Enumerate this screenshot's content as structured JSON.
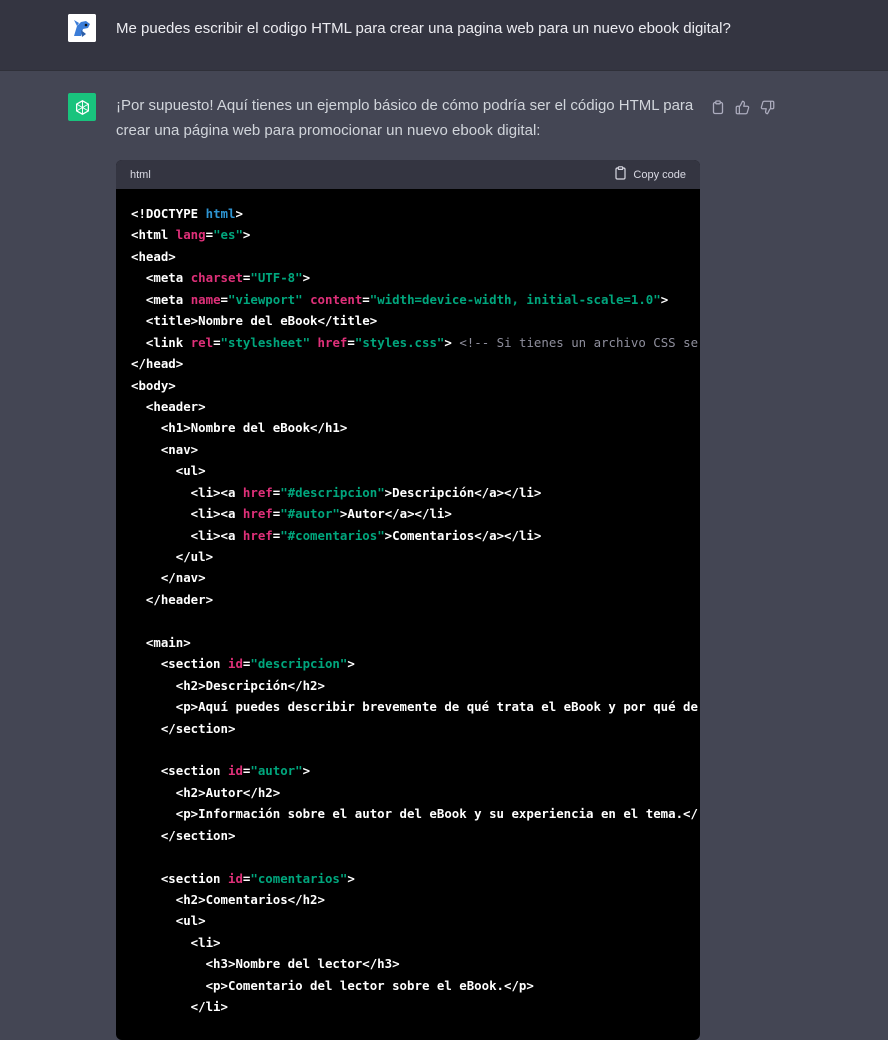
{
  "user_message": {
    "text": "Me puedes escribir el codigo HTML para crear una pagina web para un nuevo ebook digital?"
  },
  "assistant_message": {
    "intro": "¡Por supuesto! Aquí tienes un ejemplo básico de cómo podría ser el código HTML para crear una página web para promocionar un nuevo ebook digital:"
  },
  "actions": [
    {
      "name": "copy-icon"
    },
    {
      "name": "thumbs-up-icon"
    },
    {
      "name": "thumbs-down-icon"
    }
  ],
  "code_block": {
    "language": "html",
    "copy_label": "Copy code",
    "lines": [
      [
        [
          "tag",
          "<!DOCTYPE "
        ],
        [
          "kw",
          "html"
        ],
        [
          "tag",
          ">"
        ]
      ],
      [
        [
          "tag",
          "<html "
        ],
        [
          "attr",
          "lang"
        ],
        [
          "tag",
          "="
        ],
        [
          "str",
          "\"es\""
        ],
        [
          "tag",
          ">"
        ]
      ],
      [
        [
          "tag",
          "<head>"
        ]
      ],
      [
        [
          "tag",
          "  <meta "
        ],
        [
          "attr",
          "charset"
        ],
        [
          "tag",
          "="
        ],
        [
          "str",
          "\"UTF-8\""
        ],
        [
          "tag",
          ">"
        ]
      ],
      [
        [
          "tag",
          "  <meta "
        ],
        [
          "attr",
          "name"
        ],
        [
          "tag",
          "="
        ],
        [
          "str",
          "\"viewport\""
        ],
        [
          "tag",
          " "
        ],
        [
          "attr",
          "content"
        ],
        [
          "tag",
          "="
        ],
        [
          "str",
          "\"width=device-width, initial-scale=1.0\""
        ],
        [
          "tag",
          ">"
        ]
      ],
      [
        [
          "tag",
          "  <title>"
        ],
        [
          "text",
          "Nombre del eBook"
        ],
        [
          "tag",
          "</title>"
        ]
      ],
      [
        [
          "tag",
          "  <link "
        ],
        [
          "attr",
          "rel"
        ],
        [
          "tag",
          "="
        ],
        [
          "str",
          "\"stylesheet\""
        ],
        [
          "tag",
          " "
        ],
        [
          "attr",
          "href"
        ],
        [
          "tag",
          "="
        ],
        [
          "str",
          "\"styles.css\""
        ],
        [
          "tag",
          "> "
        ],
        [
          "com",
          "<!-- Si tienes un archivo CSS se"
        ]
      ],
      [
        [
          "tag",
          "</head>"
        ]
      ],
      [
        [
          "tag",
          "<body>"
        ]
      ],
      [
        [
          "tag",
          "  <header>"
        ]
      ],
      [
        [
          "tag",
          "    <h1>"
        ],
        [
          "text",
          "Nombre del eBook"
        ],
        [
          "tag",
          "</h1>"
        ]
      ],
      [
        [
          "tag",
          "    <nav>"
        ]
      ],
      [
        [
          "tag",
          "      <ul>"
        ]
      ],
      [
        [
          "tag",
          "        <li><a "
        ],
        [
          "attr",
          "href"
        ],
        [
          "tag",
          "="
        ],
        [
          "str",
          "\"#descripcion\""
        ],
        [
          "tag",
          ">"
        ],
        [
          "text",
          "Descripción"
        ],
        [
          "tag",
          "</a></li>"
        ]
      ],
      [
        [
          "tag",
          "        <li><a "
        ],
        [
          "attr",
          "href"
        ],
        [
          "tag",
          "="
        ],
        [
          "str",
          "\"#autor\""
        ],
        [
          "tag",
          ">"
        ],
        [
          "text",
          "Autor"
        ],
        [
          "tag",
          "</a></li>"
        ]
      ],
      [
        [
          "tag",
          "        <li><a "
        ],
        [
          "attr",
          "href"
        ],
        [
          "tag",
          "="
        ],
        [
          "str",
          "\"#comentarios\""
        ],
        [
          "tag",
          ">"
        ],
        [
          "text",
          "Comentarios"
        ],
        [
          "tag",
          "</a></li>"
        ]
      ],
      [
        [
          "tag",
          "      </ul>"
        ]
      ],
      [
        [
          "tag",
          "    </nav>"
        ]
      ],
      [
        [
          "tag",
          "  </header>"
        ]
      ],
      [
        [
          "tag",
          ""
        ]
      ],
      [
        [
          "tag",
          "  <main>"
        ]
      ],
      [
        [
          "tag",
          "    <section "
        ],
        [
          "attr",
          "id"
        ],
        [
          "tag",
          "="
        ],
        [
          "str",
          "\"descripcion\""
        ],
        [
          "tag",
          ">"
        ]
      ],
      [
        [
          "tag",
          "      <h2>"
        ],
        [
          "text",
          "Descripción"
        ],
        [
          "tag",
          "</h2>"
        ]
      ],
      [
        [
          "tag",
          "      <p>"
        ],
        [
          "text",
          "Aquí puedes describir brevemente de qué trata el eBook y por qué de"
        ]
      ],
      [
        [
          "tag",
          "    </section>"
        ]
      ],
      [
        [
          "tag",
          ""
        ]
      ],
      [
        [
          "tag",
          "    <section "
        ],
        [
          "attr",
          "id"
        ],
        [
          "tag",
          "="
        ],
        [
          "str",
          "\"autor\""
        ],
        [
          "tag",
          ">"
        ]
      ],
      [
        [
          "tag",
          "      <h2>"
        ],
        [
          "text",
          "Autor"
        ],
        [
          "tag",
          "</h2>"
        ]
      ],
      [
        [
          "tag",
          "      <p>"
        ],
        [
          "text",
          "Información sobre el autor del eBook y su experiencia en el tema."
        ],
        [
          "tag",
          "</"
        ]
      ],
      [
        [
          "tag",
          "    </section>"
        ]
      ],
      [
        [
          "tag",
          ""
        ]
      ],
      [
        [
          "tag",
          "    <section "
        ],
        [
          "attr",
          "id"
        ],
        [
          "tag",
          "="
        ],
        [
          "str",
          "\"comentarios\""
        ],
        [
          "tag",
          ">"
        ]
      ],
      [
        [
          "tag",
          "      <h2>"
        ],
        [
          "text",
          "Comentarios"
        ],
        [
          "tag",
          "</h2>"
        ]
      ],
      [
        [
          "tag",
          "      <ul>"
        ]
      ],
      [
        [
          "tag",
          "        <li>"
        ]
      ],
      [
        [
          "tag",
          "          <h3>"
        ],
        [
          "text",
          "Nombre del lector"
        ],
        [
          "tag",
          "</h3>"
        ]
      ],
      [
        [
          "tag",
          "          <p>"
        ],
        [
          "text",
          "Comentario del lector sobre el eBook."
        ],
        [
          "tag",
          "</p>"
        ]
      ],
      [
        [
          "tag",
          "        </li>"
        ]
      ]
    ]
  }
}
